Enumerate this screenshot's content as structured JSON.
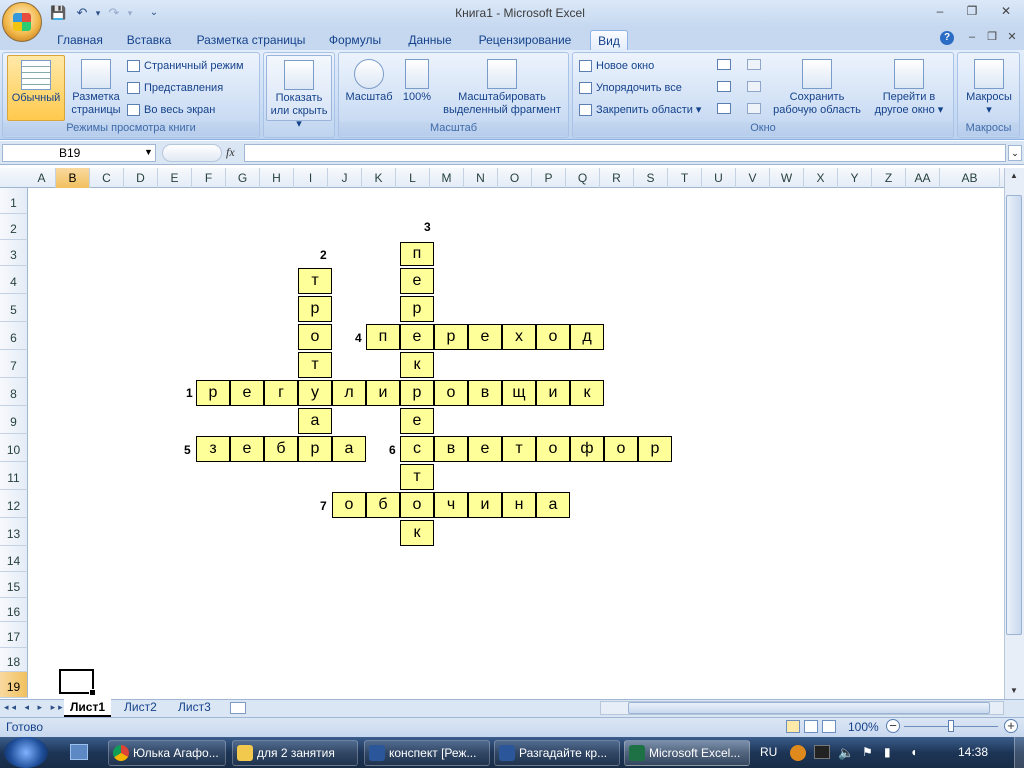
{
  "window": {
    "title": "Книга1 - Microsoft Excel"
  },
  "tabs": [
    "Главная",
    "Вставка",
    "Разметка страницы",
    "Формулы",
    "Данные",
    "Рецензирование",
    "Вид"
  ],
  "active_tab": "Вид",
  "ribbon": {
    "views_group": {
      "label": "Режимы просмотра книги",
      "normal": "Обычный",
      "page_layout_1": "Разметка",
      "page_layout_2": "страницы",
      "page_break": "Страничный режим",
      "custom_views": "Представления",
      "full_screen": "Во весь экран"
    },
    "show_group": {
      "label_1": "Показать",
      "label_2": "или скрыть ▾"
    },
    "zoom_group": {
      "label": "Масштаб",
      "zoom": "Масштаб",
      "zoom100": "100%",
      "zoom_sel_1": "Масштабировать",
      "zoom_sel_2": "выделенный фрагмент"
    },
    "window_group": {
      "label": "Окно",
      "new_window": "Новое окно",
      "arrange_all": "Упорядочить все",
      "freeze": "Закрепить области ▾",
      "save_ws_1": "Сохранить",
      "save_ws_2": "рабочую область",
      "switch_1": "Перейти в",
      "switch_2": "другое окно ▾"
    },
    "macros_group": {
      "label": "Макросы",
      "macros_1": "Макросы",
      "macros_2": "▾"
    }
  },
  "formula_bar": {
    "name_box": "B19",
    "fx": "fx",
    "value": ""
  },
  "columns": [
    "A",
    "B",
    "C",
    "D",
    "E",
    "F",
    "G",
    "H",
    "I",
    "J",
    "K",
    "L",
    "M",
    "N",
    "O",
    "P",
    "Q",
    "R",
    "S",
    "T",
    "U",
    "V",
    "W",
    "X",
    "Y",
    "Z",
    "AA",
    "AB"
  ],
  "rows": [
    "1",
    "2",
    "3",
    "4",
    "5",
    "6",
    "7",
    "8",
    "9",
    "10",
    "11",
    "12",
    "13",
    "14",
    "15",
    "16",
    "17",
    "18",
    "19"
  ],
  "selected_cell": "B19",
  "crossword": {
    "clue_numbers": [
      "1",
      "2",
      "3",
      "4",
      "5",
      "6",
      "7"
    ],
    "words": {
      "w1": [
        "р",
        "е",
        "г",
        "у",
        "л",
        "и",
        "р",
        "о",
        "в",
        "щ",
        "и",
        "к"
      ],
      "w2": [
        "т",
        "р",
        "о",
        "т",
        "у",
        "а",
        "р"
      ],
      "w3": [
        "п",
        "е",
        "р",
        "е",
        "к",
        "р",
        "е",
        "с",
        "т",
        "о",
        "к"
      ],
      "w4": [
        "п",
        "е",
        "р",
        "е",
        "х",
        "о",
        "д"
      ],
      "w5": [
        "з",
        "е",
        "б",
        "р",
        "а"
      ],
      "w6": [
        "с",
        "в",
        "е",
        "т",
        "о",
        "ф",
        "о",
        "р"
      ],
      "w7": [
        "о",
        "б",
        "о",
        "ч",
        "и",
        "н",
        "а"
      ]
    }
  },
  "sheet_tabs": [
    "Лист1",
    "Лист2",
    "Лист3"
  ],
  "active_sheet": "Лист1",
  "status": {
    "ready": "Готово",
    "zoom": "100%"
  },
  "taskbar": {
    "items": [
      "Юлька Агафо...",
      "для 2 занятия",
      "конспект [Реж...",
      "Разгадайте кр...",
      "Microsoft Excel..."
    ],
    "lang": "RU",
    "clock": "14:38"
  }
}
